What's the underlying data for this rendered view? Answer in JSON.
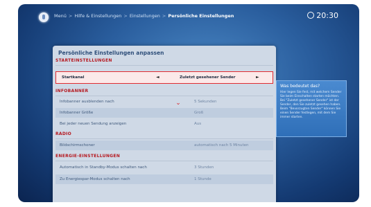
{
  "header": {
    "breadcrumb": [
      "Menü",
      "Hilfe & Einstellungen",
      "Einstellungen"
    ],
    "current": "Persönliche Einstellungen",
    "time": "20:30"
  },
  "panel": {
    "title": "Persönliche Einstellungen anpassen",
    "sections": {
      "start": "STARTEINSTELLUNGEN",
      "info": "INFOBANNER",
      "radio": "RADIO",
      "energy": "ENERGIE-EINSTELLUNGEN"
    },
    "rows": {
      "startkanal": {
        "label": "Startkanal",
        "value": "Zuletzt gesehener Sender"
      },
      "ausblenden": {
        "label": "Infobanner ausblenden nach",
        "value": "5 Sekunden"
      },
      "groesse": {
        "label": "Infobanner Größe",
        "value": "Groß"
      },
      "anzeigen": {
        "label": "Bei jeder neuen Sendung anzeigen",
        "value": "Aus"
      },
      "bildschirmschoner": {
        "label": "Bildschirmschoner",
        "value": "automatisch nach 5 Minuten"
      },
      "standby": {
        "label": "Automatisch in Standby-Modus schalten nach",
        "value": "3 Stunden"
      },
      "energiespar": {
        "label": "Zu Energiespar-Modus schalten nach",
        "value": "1 Stunde"
      }
    }
  },
  "help": {
    "title": "Was bedeutet das?",
    "body": "Hier legen Sie fest, mit welchem Sender Sie beim Einschalten starten möchten. Bei \"Zuletzt gesehener Sender\" ist der Sender, den Sie zuletzt gesehen haben. Beim \"Bevorzugten Sender\" können Sie einen Sender festlegen, mit dem Sie immer starten."
  }
}
